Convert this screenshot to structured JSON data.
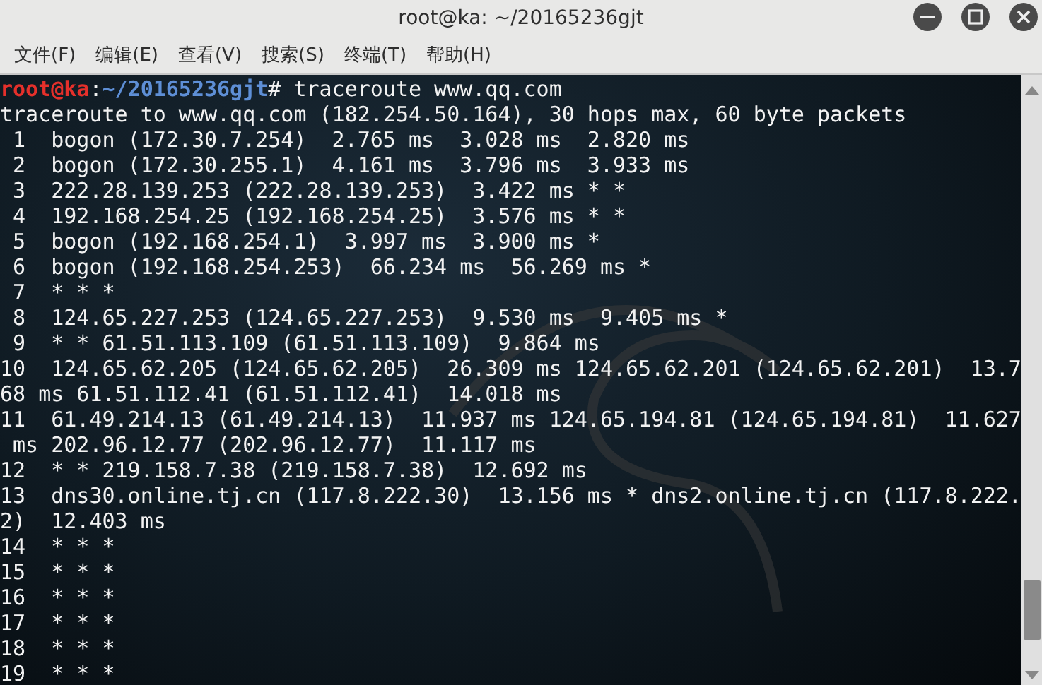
{
  "window": {
    "title": "root@ka: ~/20165236gjt"
  },
  "menu": [
    "文件(F)",
    "编辑(E)",
    "查看(V)",
    "搜索(S)",
    "终端(T)",
    "帮助(H)"
  ],
  "terminal": {
    "prompt": {
      "user": "root@ka",
      "separator": ":",
      "path": "~/20165236gjt",
      "command": "# traceroute www.qq.com"
    },
    "lines": [
      "traceroute to www.qq.com (182.254.50.164), 30 hops max, 60 byte packets",
      " 1  bogon (172.30.7.254)  2.765 ms  3.028 ms  2.820 ms",
      " 2  bogon (172.30.255.1)  4.161 ms  3.796 ms  3.933 ms",
      " 3  222.28.139.253 (222.28.139.253)  3.422 ms * *",
      " 4  192.168.254.25 (192.168.254.25)  3.576 ms * *",
      " 5  bogon (192.168.254.1)  3.997 ms  3.900 ms *",
      " 6  bogon (192.168.254.253)  66.234 ms  56.269 ms *",
      " 7  * * *",
      " 8  124.65.227.253 (124.65.227.253)  9.530 ms  9.405 ms *",
      " 9  * * 61.51.113.109 (61.51.113.109)  9.864 ms",
      "10  124.65.62.205 (124.65.62.205)  26.309 ms 124.65.62.201 (124.65.62.201)  13.7",
      "68 ms 61.51.112.41 (61.51.112.41)  14.018 ms",
      "11  61.49.214.13 (61.49.214.13)  11.937 ms 124.65.194.81 (124.65.194.81)  11.627",
      " ms 202.96.12.77 (202.96.12.77)  11.117 ms",
      "12  * * 219.158.7.38 (219.158.7.38)  12.692 ms",
      "13  dns30.online.tj.cn (117.8.222.30)  13.156 ms * dns2.online.tj.cn (117.8.222.",
      "2)  12.403 ms",
      "14  * * *",
      "15  * * *",
      "16  * * *",
      "17  * * *",
      "18  * * *",
      "19  * * *"
    ]
  }
}
